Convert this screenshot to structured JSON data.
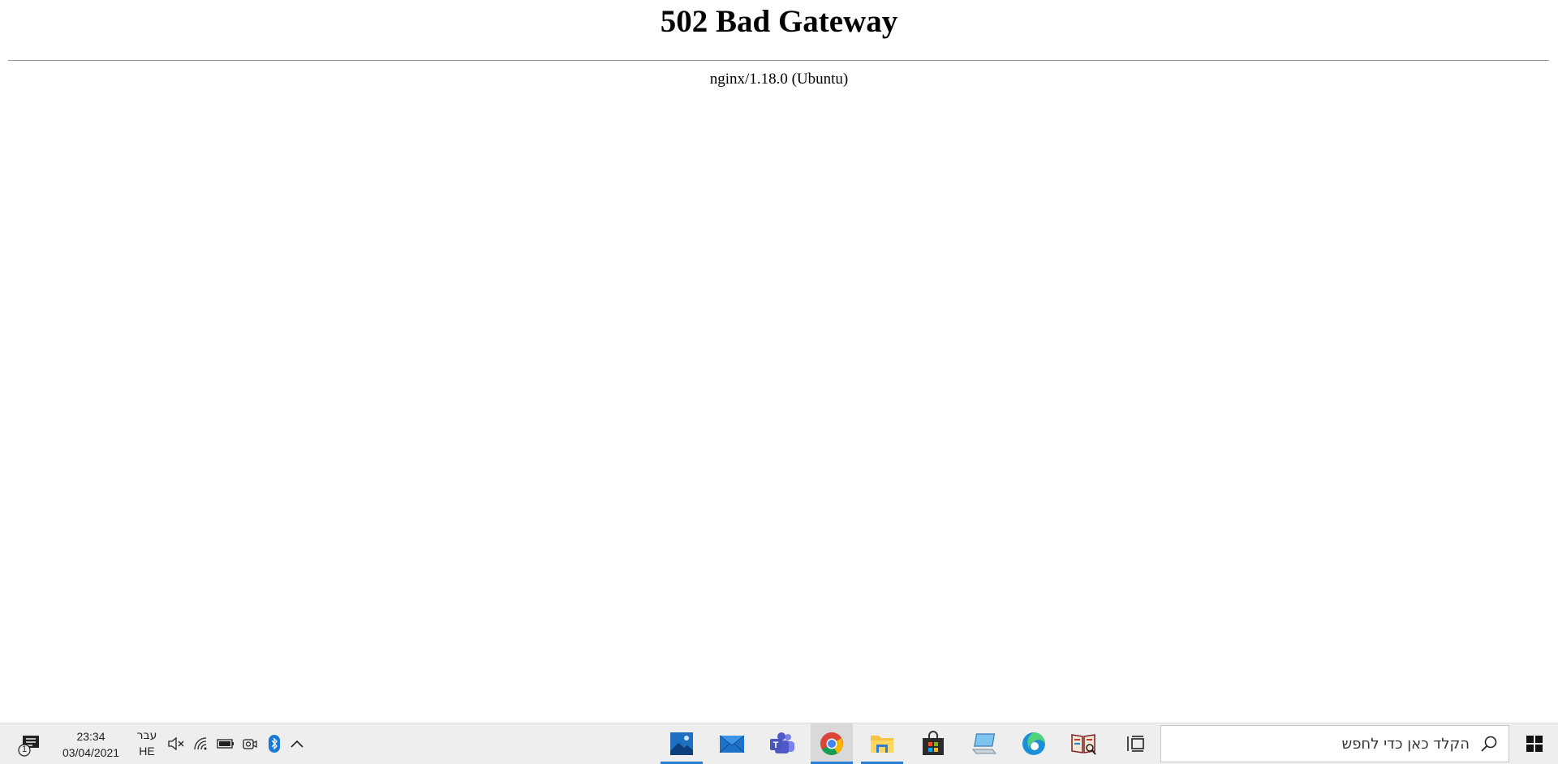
{
  "page": {
    "heading": "502 Bad Gateway",
    "server": "nginx/1.18.0 (Ubuntu)"
  },
  "taskbar": {
    "search_placeholder": "הקלד כאן כדי לחפש",
    "clock": {
      "time": "23:34",
      "date": "03/04/2021"
    },
    "language": {
      "primary": "עבר",
      "code": "HE"
    },
    "notification_count": "1",
    "accent": "#2a7fd4",
    "apps": [
      {
        "name": "photos-app",
        "icon": "photos-icon",
        "running": true
      },
      {
        "name": "mail-app",
        "icon": "mail-icon",
        "running": false
      },
      {
        "name": "teams-app",
        "icon": "teams-icon",
        "running": false
      },
      {
        "name": "chrome-app",
        "icon": "chrome-icon",
        "running": true
      },
      {
        "name": "file-explorer-app",
        "icon": "folder-icon",
        "running": true
      },
      {
        "name": "store-app",
        "icon": "store-icon",
        "running": false
      },
      {
        "name": "this-pc-app",
        "icon": "computer-icon",
        "running": false
      },
      {
        "name": "edge-app",
        "icon": "edge-icon",
        "running": false
      },
      {
        "name": "reader-app",
        "icon": "book-icon",
        "running": false
      }
    ]
  }
}
